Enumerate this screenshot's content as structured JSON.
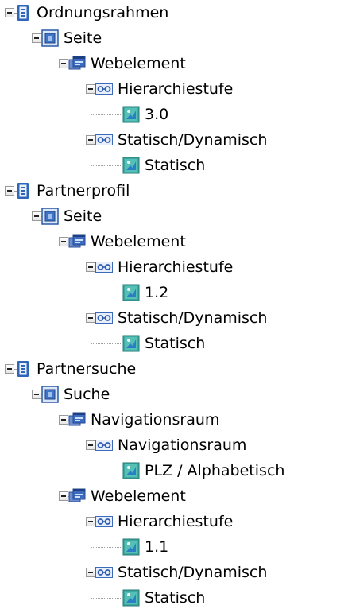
{
  "tree": [
    {
      "label": "Ordnungsrahmen",
      "icon": "document-icon",
      "children": [
        {
          "label": "Seite",
          "icon": "page-icon",
          "children": [
            {
              "label": "Webelement",
              "icon": "web-element-icon",
              "children": [
                {
                  "label": "Hierarchiestufe",
                  "icon": "attribute-icon",
                  "children": [
                    {
                      "label": "3.0",
                      "icon": "value-icon",
                      "children": []
                    }
                  ]
                },
                {
                  "label": "Statisch/Dynamisch",
                  "icon": "attribute-icon",
                  "children": [
                    {
                      "label": "Statisch",
                      "icon": "value-icon",
                      "children": []
                    }
                  ]
                }
              ]
            }
          ]
        }
      ]
    },
    {
      "label": "Partnerprofil",
      "icon": "document-icon",
      "children": [
        {
          "label": "Seite",
          "icon": "page-icon",
          "children": [
            {
              "label": "Webelement",
              "icon": "web-element-icon",
              "children": [
                {
                  "label": "Hierarchiestufe",
                  "icon": "attribute-icon",
                  "children": [
                    {
                      "label": "1.2",
                      "icon": "value-icon",
                      "children": []
                    }
                  ]
                },
                {
                  "label": "Statisch/Dynamisch",
                  "icon": "attribute-icon",
                  "children": [
                    {
                      "label": "Statisch",
                      "icon": "value-icon",
                      "children": []
                    }
                  ]
                }
              ]
            }
          ]
        }
      ]
    },
    {
      "label": "Partnersuche",
      "icon": "document-icon",
      "children": [
        {
          "label": "Suche",
          "icon": "page-icon",
          "children": [
            {
              "label": "Navigationsraum",
              "icon": "web-element-icon",
              "children": [
                {
                  "label": "Navigationsraum",
                  "icon": "attribute-icon",
                  "children": [
                    {
                      "label": "PLZ / Alphabetisch",
                      "icon": "value-icon",
                      "children": []
                    }
                  ]
                }
              ]
            },
            {
              "label": "Webelement",
              "icon": "web-element-icon",
              "children": [
                {
                  "label": "Hierarchiestufe",
                  "icon": "attribute-icon",
                  "children": [
                    {
                      "label": "1.1",
                      "icon": "value-icon",
                      "children": []
                    }
                  ]
                },
                {
                  "label": "Statisch/Dynamisch",
                  "icon": "attribute-icon",
                  "children": [
                    {
                      "label": "Statisch",
                      "icon": "value-icon",
                      "children": []
                    }
                  ]
                }
              ]
            }
          ]
        }
      ]
    }
  ]
}
